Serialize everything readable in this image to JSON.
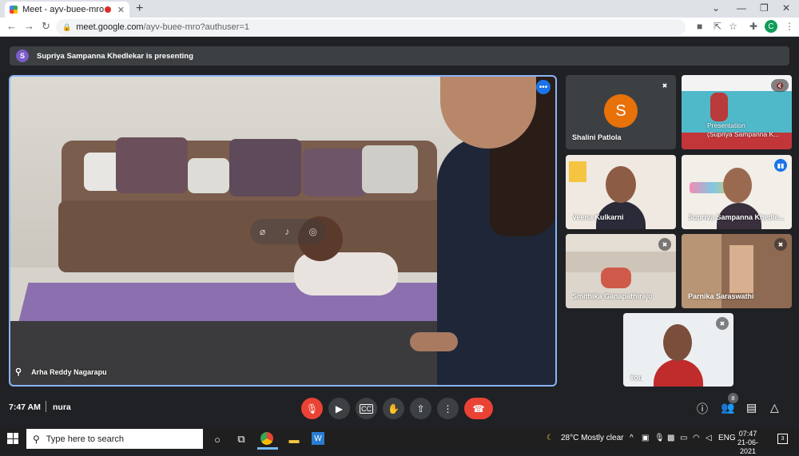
{
  "browser": {
    "tab_title": "Meet - ayv-buee-mro",
    "url_host": "meet.google.com",
    "url_path": "/ayv-buee-mro?authuser=1",
    "profile_initial": "C"
  },
  "meet": {
    "presenting_initial": "S",
    "presenting_text": "Supriya Sampanna Khedlekar is presenting",
    "main_tile": {
      "name": "Arha Reddy Nagarapu"
    },
    "participants": [
      {
        "name": "Shalini Patlola",
        "avatar_initial": "S",
        "muted": true
      },
      {
        "name": "Presentation",
        "name2": "(Supriya Sampanna K...",
        "muted": true
      },
      {
        "name": "Veena Kulkarni",
        "muted": false
      },
      {
        "name": "Supriya Sampanna Khedle...",
        "muted": false,
        "speaking": true
      },
      {
        "name": "Smithika Ganapathiraju",
        "muted": true
      },
      {
        "name": "Parnika Saraswathi",
        "muted": true
      },
      {
        "name": "You",
        "muted": true
      }
    ],
    "time": "7:47 AM",
    "meeting_code": "nura",
    "people_count": "8",
    "accent_blue": "#1a73e8",
    "end_call_red": "#ea4335"
  },
  "taskbar": {
    "search_placeholder": "Type here to search",
    "weather": "28°C  Mostly clear",
    "lang": "ENG",
    "time": "07:47",
    "date": "21-06-2021",
    "notifications": "3"
  }
}
